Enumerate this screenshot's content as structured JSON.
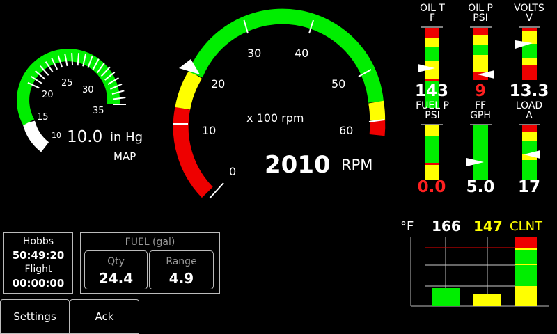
{
  "map_gauge": {
    "ticks": [
      "10",
      "15",
      "20",
      "25",
      "30",
      "35"
    ],
    "value": "10.0",
    "unit": "in Hg",
    "label": "MAP"
  },
  "rpm_gauge": {
    "ticks": [
      "0",
      "10",
      "20",
      "30",
      "40",
      "50",
      "60"
    ],
    "multiplier": "x 100 rpm",
    "value": "2010",
    "unit": "RPM"
  },
  "bars": [
    {
      "label": "OIL T",
      "unit": "F",
      "value": "143",
      "value_color": "#ffffff"
    },
    {
      "label": "OIL P",
      "unit": "PSI",
      "value": "9",
      "value_color": "#ff2020"
    },
    {
      "label": "VOLTS",
      "unit": "V",
      "value": "13.3",
      "value_color": "#ffffff"
    },
    {
      "label": "FUEL P",
      "unit": "PSI",
      "value": "0.0",
      "value_color": "#ff2020"
    },
    {
      "label": "FF",
      "unit": "GPH",
      "value": "5.0",
      "value_color": "#ffffff"
    },
    {
      "label": "LOAD",
      "unit": "A",
      "value": "17",
      "value_color": "#ffffff"
    }
  ],
  "temps": {
    "unit": "°F",
    "egt1": "166",
    "egt2": "147",
    "clnt": "CLNT",
    "egt1_fill": 0.26,
    "egt2_fill": 0.17
  },
  "hobbs": {
    "hobbs_label": "Hobbs",
    "hobbs_value": "50:49:20",
    "flight_label": "Flight",
    "flight_value": "00:00:00"
  },
  "fuel": {
    "title": "FUEL (gal)",
    "qty_label": "Qty",
    "qty_value": "24.4",
    "range_label": "Range",
    "range_value": "4.9"
  },
  "buttons": {
    "settings": "Settings",
    "ack": "Ack"
  },
  "colors": {
    "green": "#00ee00",
    "yellow": "#ffff00",
    "red": "#ee0000"
  }
}
